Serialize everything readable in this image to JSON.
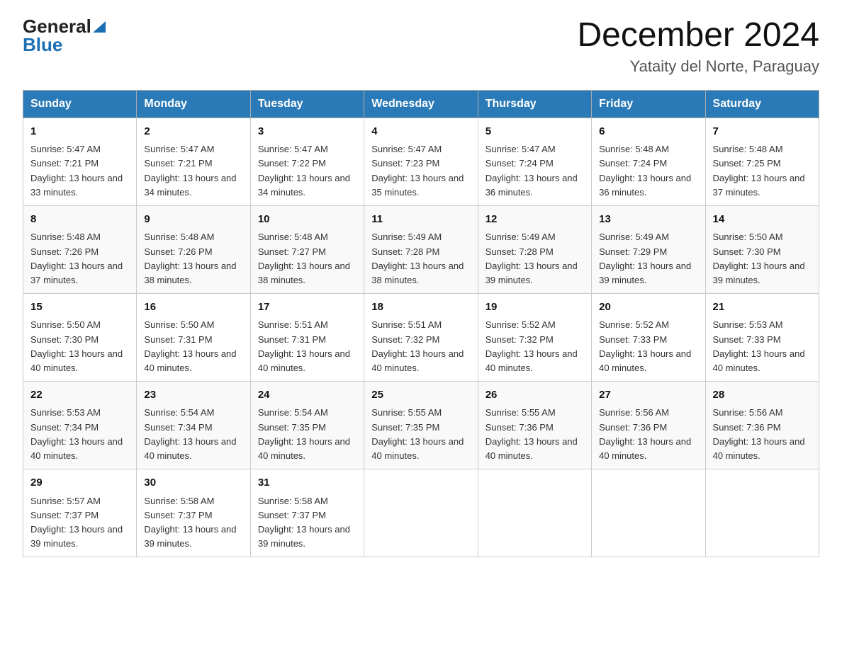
{
  "header": {
    "logo": {
      "general": "General",
      "blue": "Blue"
    },
    "month": "December 2024",
    "location": "Yataity del Norte, Paraguay"
  },
  "days_of_week": [
    "Sunday",
    "Monday",
    "Tuesday",
    "Wednesday",
    "Thursday",
    "Friday",
    "Saturday"
  ],
  "weeks": [
    [
      {
        "num": "1",
        "sunrise": "5:47 AM",
        "sunset": "7:21 PM",
        "daylight": "13 hours and 33 minutes."
      },
      {
        "num": "2",
        "sunrise": "5:47 AM",
        "sunset": "7:21 PM",
        "daylight": "13 hours and 34 minutes."
      },
      {
        "num": "3",
        "sunrise": "5:47 AM",
        "sunset": "7:22 PM",
        "daylight": "13 hours and 34 minutes."
      },
      {
        "num": "4",
        "sunrise": "5:47 AM",
        "sunset": "7:23 PM",
        "daylight": "13 hours and 35 minutes."
      },
      {
        "num": "5",
        "sunrise": "5:47 AM",
        "sunset": "7:24 PM",
        "daylight": "13 hours and 36 minutes."
      },
      {
        "num": "6",
        "sunrise": "5:48 AM",
        "sunset": "7:24 PM",
        "daylight": "13 hours and 36 minutes."
      },
      {
        "num": "7",
        "sunrise": "5:48 AM",
        "sunset": "7:25 PM",
        "daylight": "13 hours and 37 minutes."
      }
    ],
    [
      {
        "num": "8",
        "sunrise": "5:48 AM",
        "sunset": "7:26 PM",
        "daylight": "13 hours and 37 minutes."
      },
      {
        "num": "9",
        "sunrise": "5:48 AM",
        "sunset": "7:26 PM",
        "daylight": "13 hours and 38 minutes."
      },
      {
        "num": "10",
        "sunrise": "5:48 AM",
        "sunset": "7:27 PM",
        "daylight": "13 hours and 38 minutes."
      },
      {
        "num": "11",
        "sunrise": "5:49 AM",
        "sunset": "7:28 PM",
        "daylight": "13 hours and 38 minutes."
      },
      {
        "num": "12",
        "sunrise": "5:49 AM",
        "sunset": "7:28 PM",
        "daylight": "13 hours and 39 minutes."
      },
      {
        "num": "13",
        "sunrise": "5:49 AM",
        "sunset": "7:29 PM",
        "daylight": "13 hours and 39 minutes."
      },
      {
        "num": "14",
        "sunrise": "5:50 AM",
        "sunset": "7:30 PM",
        "daylight": "13 hours and 39 minutes."
      }
    ],
    [
      {
        "num": "15",
        "sunrise": "5:50 AM",
        "sunset": "7:30 PM",
        "daylight": "13 hours and 40 minutes."
      },
      {
        "num": "16",
        "sunrise": "5:50 AM",
        "sunset": "7:31 PM",
        "daylight": "13 hours and 40 minutes."
      },
      {
        "num": "17",
        "sunrise": "5:51 AM",
        "sunset": "7:31 PM",
        "daylight": "13 hours and 40 minutes."
      },
      {
        "num": "18",
        "sunrise": "5:51 AM",
        "sunset": "7:32 PM",
        "daylight": "13 hours and 40 minutes."
      },
      {
        "num": "19",
        "sunrise": "5:52 AM",
        "sunset": "7:32 PM",
        "daylight": "13 hours and 40 minutes."
      },
      {
        "num": "20",
        "sunrise": "5:52 AM",
        "sunset": "7:33 PM",
        "daylight": "13 hours and 40 minutes."
      },
      {
        "num": "21",
        "sunrise": "5:53 AM",
        "sunset": "7:33 PM",
        "daylight": "13 hours and 40 minutes."
      }
    ],
    [
      {
        "num": "22",
        "sunrise": "5:53 AM",
        "sunset": "7:34 PM",
        "daylight": "13 hours and 40 minutes."
      },
      {
        "num": "23",
        "sunrise": "5:54 AM",
        "sunset": "7:34 PM",
        "daylight": "13 hours and 40 minutes."
      },
      {
        "num": "24",
        "sunrise": "5:54 AM",
        "sunset": "7:35 PM",
        "daylight": "13 hours and 40 minutes."
      },
      {
        "num": "25",
        "sunrise": "5:55 AM",
        "sunset": "7:35 PM",
        "daylight": "13 hours and 40 minutes."
      },
      {
        "num": "26",
        "sunrise": "5:55 AM",
        "sunset": "7:36 PM",
        "daylight": "13 hours and 40 minutes."
      },
      {
        "num": "27",
        "sunrise": "5:56 AM",
        "sunset": "7:36 PM",
        "daylight": "13 hours and 40 minutes."
      },
      {
        "num": "28",
        "sunrise": "5:56 AM",
        "sunset": "7:36 PM",
        "daylight": "13 hours and 40 minutes."
      }
    ],
    [
      {
        "num": "29",
        "sunrise": "5:57 AM",
        "sunset": "7:37 PM",
        "daylight": "13 hours and 39 minutes."
      },
      {
        "num": "30",
        "sunrise": "5:58 AM",
        "sunset": "7:37 PM",
        "daylight": "13 hours and 39 minutes."
      },
      {
        "num": "31",
        "sunrise": "5:58 AM",
        "sunset": "7:37 PM",
        "daylight": "13 hours and 39 minutes."
      },
      null,
      null,
      null,
      null
    ]
  ]
}
